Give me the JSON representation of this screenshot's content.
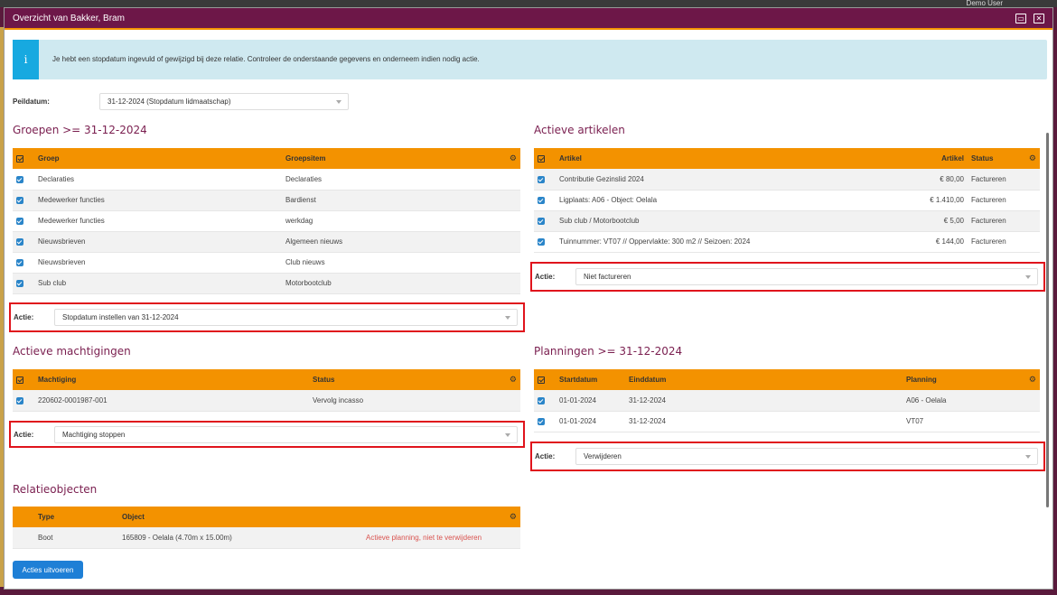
{
  "bg": {
    "user": "Demo User"
  },
  "window": {
    "title": "Overzicht van Bakker, Bram"
  },
  "info": {
    "icon": "i",
    "text": "Je hebt een stopdatum ingevuld of gewijzigd bij deze relatie. Controleer de onderstaande gegevens en onderneem indien nodig actie."
  },
  "peildatum": {
    "label": "Peildatum:",
    "value": "31-12-2024 (Stopdatum lidmaatschap)"
  },
  "groepen": {
    "title": "Groepen >= 31-12-2024",
    "headers": [
      "Groep",
      "Groepsitem"
    ],
    "rows": [
      [
        "Declaraties",
        "Declaraties"
      ],
      [
        "Medewerker functies",
        "Bardienst"
      ],
      [
        "Medewerker functies",
        "werkdag"
      ],
      [
        "Nieuwsbrieven",
        "Algemeen nieuws"
      ],
      [
        "Nieuwsbrieven",
        "Club nieuws"
      ],
      [
        "Sub club",
        "Motorbootclub"
      ]
    ],
    "action_label": "Actie:",
    "action_value": "Stopdatum instellen van 31-12-2024"
  },
  "artikelen": {
    "title": "Actieve artikelen",
    "headers": [
      "Artikel",
      "Artikel",
      "Status"
    ],
    "rows": [
      [
        "Contributie Gezinslid 2024",
        "€ 80,00",
        "Factureren"
      ],
      [
        "Ligplaats: A06 - Object: Oelala",
        "€ 1.410,00",
        "Factureren"
      ],
      [
        "Sub club / Motorbootclub",
        "€ 5,00",
        "Factureren"
      ],
      [
        "Tuinnummer: VT07 // Oppervlakte: 300 m2 // Seizoen: 2024",
        "€ 144,00",
        "Factureren"
      ]
    ],
    "action_label": "Actie:",
    "action_value": "Niet factureren"
  },
  "machtigingen": {
    "title": "Actieve machtigingen",
    "headers": [
      "Machtiging",
      "Status"
    ],
    "rows": [
      [
        "220602-0001987-001",
        "Vervolg incasso"
      ]
    ],
    "action_label": "Actie:",
    "action_value": "Machtiging stoppen"
  },
  "planningen": {
    "title": "Planningen >= 31-12-2024",
    "headers": [
      "Startdatum",
      "Einddatum",
      "Planning"
    ],
    "rows": [
      [
        "01-01-2024",
        "31-12-2024",
        "A06 - Oelala"
      ],
      [
        "01-01-2024",
        "31-12-2024",
        "VT07"
      ]
    ],
    "action_label": "Actie:",
    "action_value": "Verwijderen"
  },
  "relatieobjecten": {
    "title": "Relatieobjecten",
    "headers": [
      "Type",
      "Object"
    ],
    "rows": [
      [
        "Boot",
        "165809 - Oelala (4.70m x 15.00m)",
        "Actieve planning, niet te verwijderen"
      ]
    ]
  },
  "button": {
    "label": "Acties uitvoeren"
  },
  "colors": {
    "title_bar": "#6d1748",
    "header": "#f39200",
    "accent": "#7a1e4f",
    "highlight": "#e0141c",
    "button": "#1e7fd6"
  },
  "icons": {
    "settings": "gear-icon",
    "checkbox": "checkbox-icon",
    "info": "info-icon"
  }
}
